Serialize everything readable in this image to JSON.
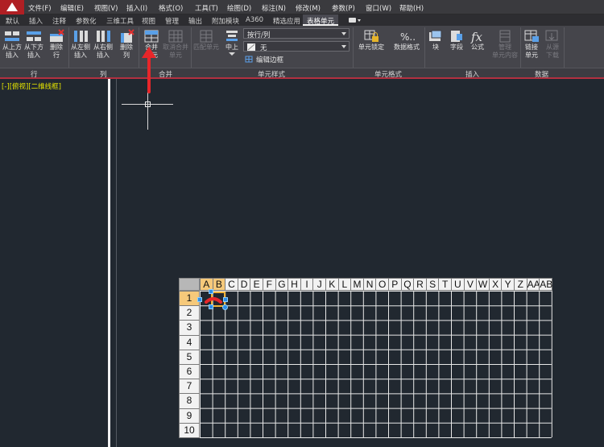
{
  "menu": [
    "文件(F)",
    "编辑(E)",
    "视图(V)",
    "插入(I)",
    "格式(O)",
    "工具(T)",
    "绘图(D)",
    "标注(N)",
    "修改(M)",
    "参数(P)",
    "窗口(W)",
    "帮助(H)"
  ],
  "tabs": [
    "默认",
    "插入",
    "注释",
    "参数化",
    "三维工具",
    "视图",
    "管理",
    "输出",
    "附加模块",
    "A360",
    "精选应用",
    "表格单元"
  ],
  "active_tab": "表格单元",
  "ribbon": {
    "row": {
      "title": "行",
      "above": "从上方\n插入",
      "below": "从下方\n插入",
      "delete": "删除\n行"
    },
    "col": {
      "title": "列",
      "left": "从左侧\n插入",
      "right": "从右侧\n插入",
      "delete": "删除\n列"
    },
    "merge": {
      "title": "合并",
      "merge": "合并\n单元",
      "unmerge": "取消合并\n单元"
    },
    "style": {
      "title": "单元样式",
      "match": "匹配单元",
      "align": "中上",
      "dropdown1": "按行/列",
      "dropdown2": "无",
      "edit_borders": "编辑边框"
    },
    "format": {
      "title": "单元格式",
      "lock": "单元锁定",
      "data": "数据格式"
    },
    "insert": {
      "title": "插入",
      "block": "块",
      "field": "字段",
      "formula": "公式",
      "manage": "管理\n单元内容"
    },
    "data": {
      "title": "数据",
      "link": "链接\n单元",
      "download": "从源\n下载"
    }
  },
  "view_label": "[-][俯视][二维线框]",
  "table": {
    "columns": [
      "A",
      "B",
      "C",
      "D",
      "E",
      "F",
      "G",
      "H",
      "I",
      "J",
      "K",
      "L",
      "M",
      "N",
      "O",
      "P",
      "Q",
      "R",
      "S",
      "T",
      "U",
      "V",
      "W",
      "X",
      "Y",
      "Z",
      "AA",
      "AB"
    ],
    "rows": [
      "1",
      "2",
      "3",
      "4",
      "5",
      "6",
      "7",
      "8",
      "9",
      "10"
    ],
    "selected_columns": [
      "A",
      "B"
    ],
    "selected_row": "1"
  },
  "colors": {
    "background": "#212830",
    "ribbon": "#45454b",
    "accent": "#b23040",
    "selection": "#f6c97a",
    "grip": "#2b8de8"
  }
}
